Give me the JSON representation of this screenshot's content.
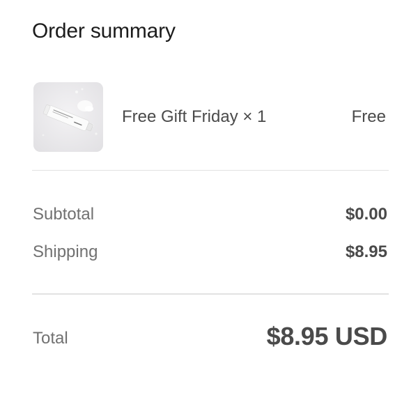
{
  "summary": {
    "title": "Order summary"
  },
  "item": {
    "name": "Free Gift Friday × 1",
    "price": "Free",
    "thumbnail_icon": "product-tube-image"
  },
  "lines": {
    "subtotal_label": "Subtotal",
    "subtotal_value": "$0.00",
    "shipping_label": "Shipping",
    "shipping_value": "$8.95"
  },
  "total": {
    "label": "Total",
    "value": "$8.95 USD"
  },
  "colors": {
    "text_dark": "#1c1c1c",
    "text_medium": "#4a4a4a",
    "text_muted": "#717171",
    "divider": "#e2e2e2",
    "thumb_bg": "#e9e8ea"
  }
}
